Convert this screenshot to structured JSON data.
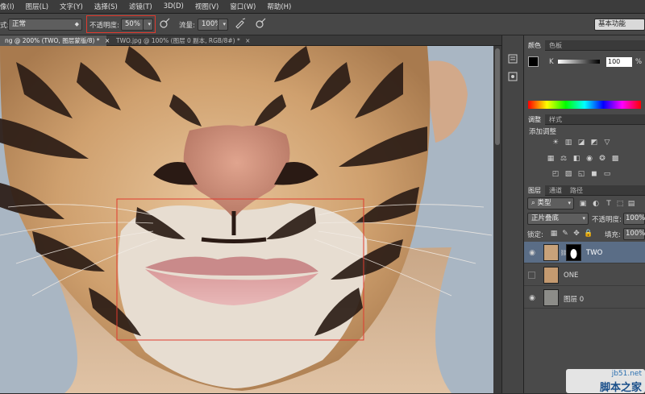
{
  "menubar": {
    "items": [
      "像(I)",
      "图层(L)",
      "文字(Y)",
      "选择(S)",
      "滤镜(T)",
      "3D(D)",
      "视图(V)",
      "窗口(W)",
      "帮助(H)"
    ]
  },
  "options": {
    "mode_label": "式:",
    "mode_value": "正常",
    "opacity_label": "不透明度:",
    "opacity_value": "50%",
    "flow_label": "流量:",
    "flow_value": "100%",
    "workspace": "基本功能"
  },
  "doc_tabs": [
    {
      "label": "ng @ 200% (TWO, 图层蒙版/8) *",
      "close": "×"
    },
    {
      "label": "TWO.jpg @ 100% (图层 0 副本, RGB/8#) *",
      "close": "×"
    }
  ],
  "color_panel": {
    "tabs": [
      "颜色",
      "色板"
    ],
    "channel": "K",
    "value": "100",
    "unit": "%"
  },
  "adjust_panel": {
    "tabs": [
      "调整",
      "样式"
    ],
    "title": "添加调整"
  },
  "layers_panel": {
    "tabs": [
      "图层",
      "通道",
      "路径"
    ],
    "filter": "类型",
    "blend": "正片叠底",
    "opacity_label": "不透明度:",
    "opacity_value": "100%",
    "lock_label": "锁定:",
    "fill_label": "填充:",
    "fill_value": "100%",
    "layers": [
      {
        "name": "TWO",
        "selected": true
      },
      {
        "name": "ONE",
        "selected": false
      },
      {
        "name": "图层 0",
        "selected": false
      }
    ]
  },
  "watermark": {
    "site": "jb51.net",
    "text": "脚本之家"
  },
  "colors": {
    "accent_red": "#e03a2e",
    "selection_blue": "#5a6d86"
  }
}
